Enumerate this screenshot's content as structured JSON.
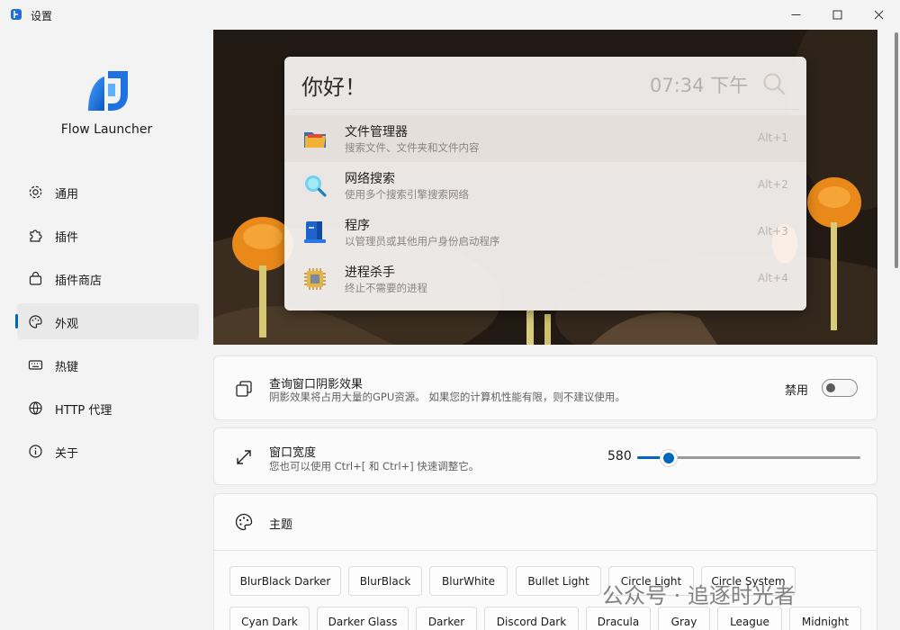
{
  "window": {
    "title": "设置"
  },
  "sidebar": {
    "app_name": "Flow Launcher",
    "items": [
      {
        "label": "通用",
        "icon": "gear-icon"
      },
      {
        "label": "插件",
        "icon": "puzzle-icon"
      },
      {
        "label": "插件商店",
        "icon": "store-bag-icon"
      },
      {
        "label": "外观",
        "icon": "palette-icon",
        "active": true
      },
      {
        "label": "热键",
        "icon": "keyboard-icon"
      },
      {
        "label": "HTTP 代理",
        "icon": "globe-icon"
      },
      {
        "label": "关于",
        "icon": "info-icon"
      }
    ]
  },
  "preview": {
    "query": "你好！",
    "clock": "07:34 下午",
    "results": [
      {
        "title": "文件管理器",
        "subtitle": "搜索文件、文件夹和文件内容",
        "hotkey": "Alt+1",
        "icon": "folder-icon"
      },
      {
        "title": "网络搜索",
        "subtitle": "使用多个搜索引擎搜索网络",
        "hotkey": "Alt+2",
        "icon": "web-search-icon"
      },
      {
        "title": "程序",
        "subtitle": "以管理员或其他用户身份启动程序",
        "hotkey": "Alt+3",
        "icon": "program-icon"
      },
      {
        "title": "进程杀手",
        "subtitle": "终止不需要的进程",
        "hotkey": "Alt+4",
        "icon": "process-chip-icon"
      }
    ]
  },
  "shadow_setting": {
    "title": "查询窗口阴影效果",
    "subtitle": "阴影效果将占用大量的GPU资源。 如果您的计算机性能有限，则不建议使用。",
    "state_label": "禁用",
    "enabled": false
  },
  "width_setting": {
    "title": "窗口宽度",
    "subtitle": "您也可以使用 Ctrl+[ 和 Ctrl+] 快速调整它。",
    "value": "580",
    "slider_fraction": 0.14
  },
  "theme_setting": {
    "title": "主题",
    "themes_row1": [
      "BlurBlack Darker",
      "BlurBlack",
      "BlurWhite",
      "Bullet Light",
      "Circle Light",
      "Circle System"
    ],
    "themes_row2": [
      "Cyan Dark",
      "Darker Glass",
      "Darker",
      "Discord Dark",
      "Dracula",
      "Gray",
      "League",
      "Midnight"
    ]
  },
  "watermark": "公众号 · 追逐时光者",
  "colors": {
    "accent": "#0067c0",
    "background": "#f3f3f3",
    "card": "#fbfbfb"
  }
}
